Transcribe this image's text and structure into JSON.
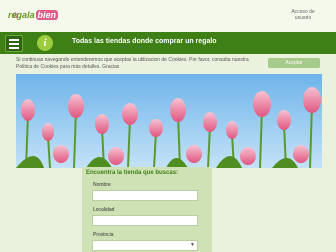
{
  "header": {
    "logo_main": "regala",
    "logo_accent": "bien",
    "account_line1": "Acceso de",
    "account_line2": "usuario"
  },
  "navbar": {
    "title": "Todas las tiendas donde comprar un regalo"
  },
  "cookies": {
    "text": "Si continuas navegando entenderemos que aceptas la utilizacion de Cookies. Por favor, consulta nuestra Politica de Cookies para más detalles. Gracias",
    "accept_label": "Aceptar"
  },
  "search": {
    "title": "Encuentra la tienda que buscas:",
    "name_label": "Nombre",
    "city_label": "Localidad",
    "province_label": "Provincia"
  },
  "colors": {
    "navbar": "#3e7f16",
    "background": "#eaf2de",
    "accent": "#e05a8a"
  }
}
